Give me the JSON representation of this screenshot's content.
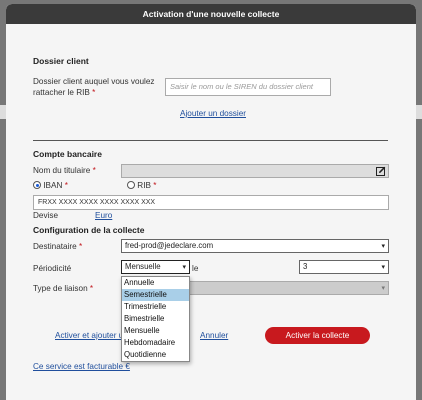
{
  "modal": {
    "title": "Activation d'une nouvelle collecte"
  },
  "dossier": {
    "section_title": "Dossier client",
    "label": "Dossier client auquel vous voulez rattacher le RIB",
    "required_mark": "*",
    "input_placeholder": "Saisir le nom ou le SIREN du dossier client",
    "add_link": "Ajouter un dossier"
  },
  "compte": {
    "section_title": "Compte bancaire",
    "holder_label": "Nom du titulaire",
    "holder_value": "",
    "iban_label": "IBAN",
    "rib_label": "RIB",
    "iban_value": "FRXX XXXX XXXX XXXX XXXX XXX",
    "devise_label": "Devise",
    "devise_value": "Euro"
  },
  "config": {
    "section_title": "Configuration de la collecte",
    "destinataire_label": "Destinataire",
    "destinataire_value": "fred-prod@jedeclare.com",
    "periodicite_label": "Périodicité",
    "periodicite_value": "Mensuelle",
    "le_label": "le",
    "day_value": "3",
    "liaison_label": "Type de liaison",
    "periodicite_options": [
      "Annuelle",
      "Semestrielle",
      "Trimestrielle",
      "Bimestrielle",
      "Mensuelle",
      "Hebdomadaire",
      "Quotidienne"
    ],
    "highlighted_option": "Semestrielle"
  },
  "footer": {
    "activate_add_link": "Activer et ajouter u",
    "cancel_link": "Annuler",
    "activate_button": "Activer la collecte",
    "billing_link": "Ce service est facturable €"
  },
  "colors": {
    "header_bg": "#3a3a3a",
    "primary": "#c8191e",
    "link": "#1f4e9c",
    "required": "#c0141a",
    "highlight": "#a9cfe8"
  }
}
